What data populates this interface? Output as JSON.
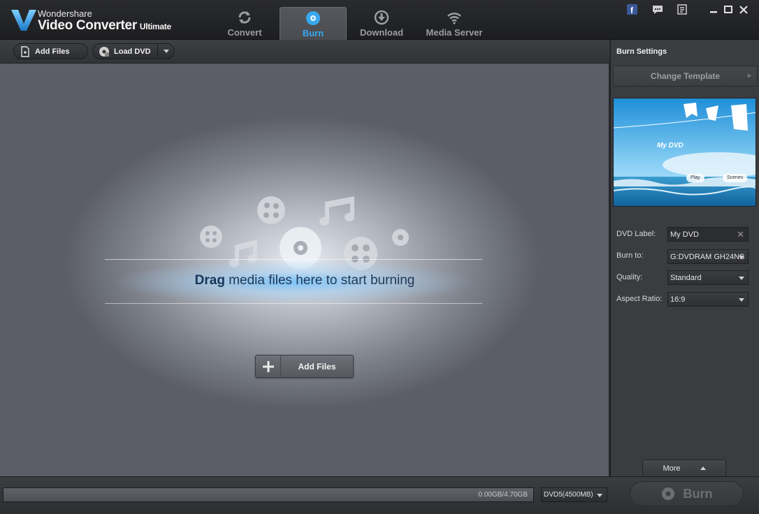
{
  "app": {
    "brand_small": "Wondershare",
    "brand_big": "Video Converter",
    "brand_edition": "Ultimate"
  },
  "tabs": [
    {
      "label": "Convert",
      "icon": "convert-icon",
      "active": false
    },
    {
      "label": "Burn",
      "icon": "disc-icon",
      "active": true
    },
    {
      "label": "Download",
      "icon": "download-icon",
      "active": false
    },
    {
      "label": "Media Server",
      "icon": "wifi-icon",
      "active": false
    }
  ],
  "toolbar": {
    "add_files_label": "Add Files",
    "load_dvd_label": "Load DVD"
  },
  "drop": {
    "prefix": "Drag",
    "message": " media files here to start burning",
    "add_files_label": "Add Files"
  },
  "burn_settings": {
    "title": "Burn Settings",
    "change_template_label": "Change Template",
    "preview_title": "My DVD",
    "preview_play": "Play",
    "preview_scenes": "Scenes",
    "dvd_label": {
      "label": "DVD Label:",
      "value": "My DVD"
    },
    "burn_to": {
      "label": "Burn to:",
      "value": "G:DVDRAM GH24NS"
    },
    "quality": {
      "label": "Quality:",
      "value": "Standard"
    },
    "aspect_ratio": {
      "label": "Aspect Ratio:",
      "value": "16:9"
    },
    "more_label": "More"
  },
  "bottom": {
    "capacity_text": "0.00GB/4.70GB",
    "disc_type": "DVD5(4500MB)",
    "burn_label": "Burn"
  },
  "colors": {
    "accent": "#38a8ee",
    "panel": "#3a3c40",
    "titlebar": "#1d1e20"
  }
}
